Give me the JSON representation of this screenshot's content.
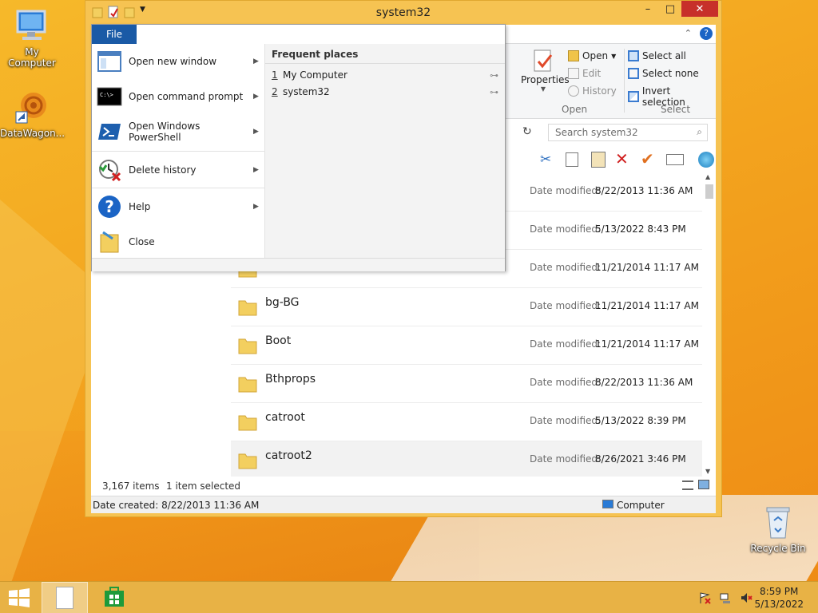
{
  "desktop": {
    "icons": [
      {
        "label": "My Computer"
      },
      {
        "label": "DataWagon..."
      },
      {
        "label": "Recycle Bin"
      }
    ]
  },
  "window": {
    "title": "system32",
    "controls": {
      "minimize": "–",
      "maximize": "□",
      "close": "✕"
    }
  },
  "ribbon": {
    "properties_label": "Properties",
    "open_group": {
      "open": "Open",
      "edit": "Edit",
      "history": "History",
      "label": "Open"
    },
    "select_group": {
      "select_all": "Select all",
      "select_none": "Select none",
      "invert": "Invert selection",
      "label": "Select"
    }
  },
  "search": {
    "placeholder": "Search system32"
  },
  "files": [
    {
      "name": "",
      "date_label": "Date modified:",
      "date": "8/22/2013 11:36 AM"
    },
    {
      "name": "",
      "date_label": "Date modified:",
      "date": "5/13/2022 8:43 PM"
    },
    {
      "name": "",
      "date_label": "Date modified:",
      "date": "11/21/2014 11:17 AM"
    },
    {
      "name": "bg-BG",
      "date_label": "Date modified:",
      "date": "11/21/2014 11:17 AM"
    },
    {
      "name": "Boot",
      "date_label": "Date modified:",
      "date": "11/21/2014 11:17 AM"
    },
    {
      "name": "Bthprops",
      "date_label": "Date modified:",
      "date": "8/22/2013 11:36 AM"
    },
    {
      "name": "catroot",
      "date_label": "Date modified:",
      "date": "5/13/2022 8:39 PM"
    },
    {
      "name": "catroot2",
      "date_label": "Date modified:",
      "date": "8/26/2021 3:46 PM",
      "selected": true
    }
  ],
  "status": {
    "items_count": "3,167 items",
    "selected": "1 item selected"
  },
  "details": {
    "date_created": "Date created: 8/22/2013 11:36 AM",
    "location": "Computer"
  },
  "file_menu": {
    "tab": "File",
    "items": [
      {
        "label": "Open new window",
        "icon": "window-icon"
      },
      {
        "label": "Open command prompt",
        "icon": "cmd-icon"
      },
      {
        "label": "Open Windows PowerShell",
        "icon": "powershell-icon"
      },
      {
        "label": "Delete history",
        "icon": "delete-history-icon"
      },
      {
        "label": "Help",
        "icon": "help-icon"
      },
      {
        "label": "Close",
        "icon": "close-folder-icon"
      }
    ],
    "frequent_title": "Frequent places",
    "frequent": [
      {
        "num": "1",
        "label": "My Computer"
      },
      {
        "num": "2",
        "label": "system32"
      }
    ]
  },
  "taskbar": {
    "time": "8:59 PM",
    "date": "5/13/2022"
  }
}
